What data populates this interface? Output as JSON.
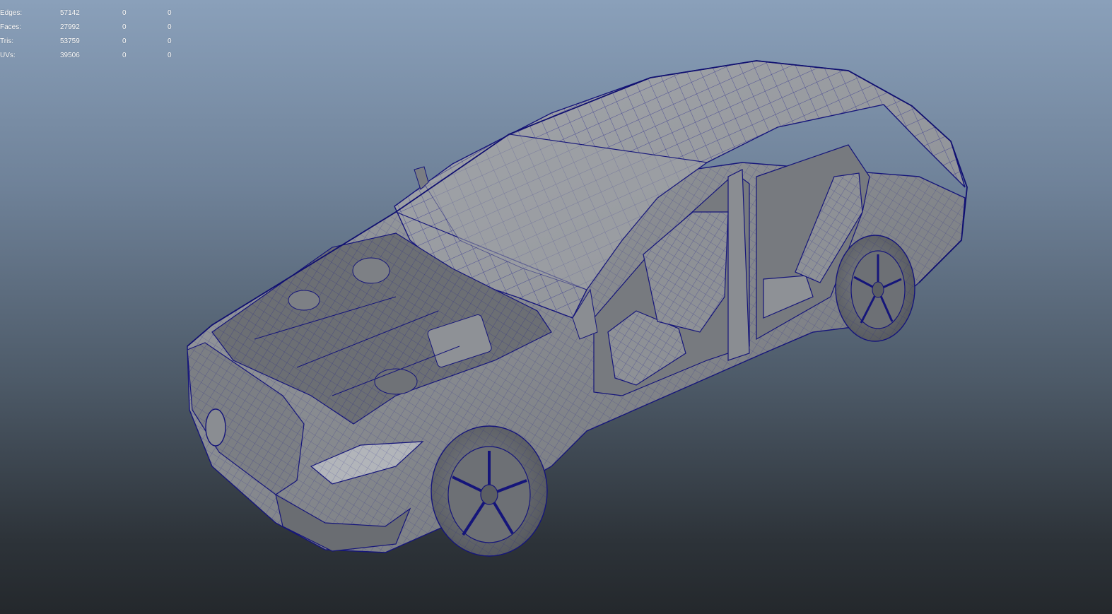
{
  "hud": {
    "rows": [
      {
        "label": "Edges:",
        "total": "57142",
        "selected": "0",
        "triangles_selected": "0"
      },
      {
        "label": "Faces:",
        "total": "27992",
        "selected": "0",
        "triangles_selected": "0"
      },
      {
        "label": "Tris:",
        "total": "53759",
        "selected": "0",
        "triangles_selected": "0"
      },
      {
        "label": "UVs:",
        "total": "39506",
        "selected": "0",
        "triangles_selected": "0"
      }
    ]
  },
  "colors": {
    "background_top": "#8aa0ba",
    "background_bottom": "#24282c",
    "mesh_fill": "#8e9196",
    "wireframe": "#15157a",
    "hud_text": "#ffffff"
  },
  "icons": {
    "model": "car-wireframe-model"
  }
}
